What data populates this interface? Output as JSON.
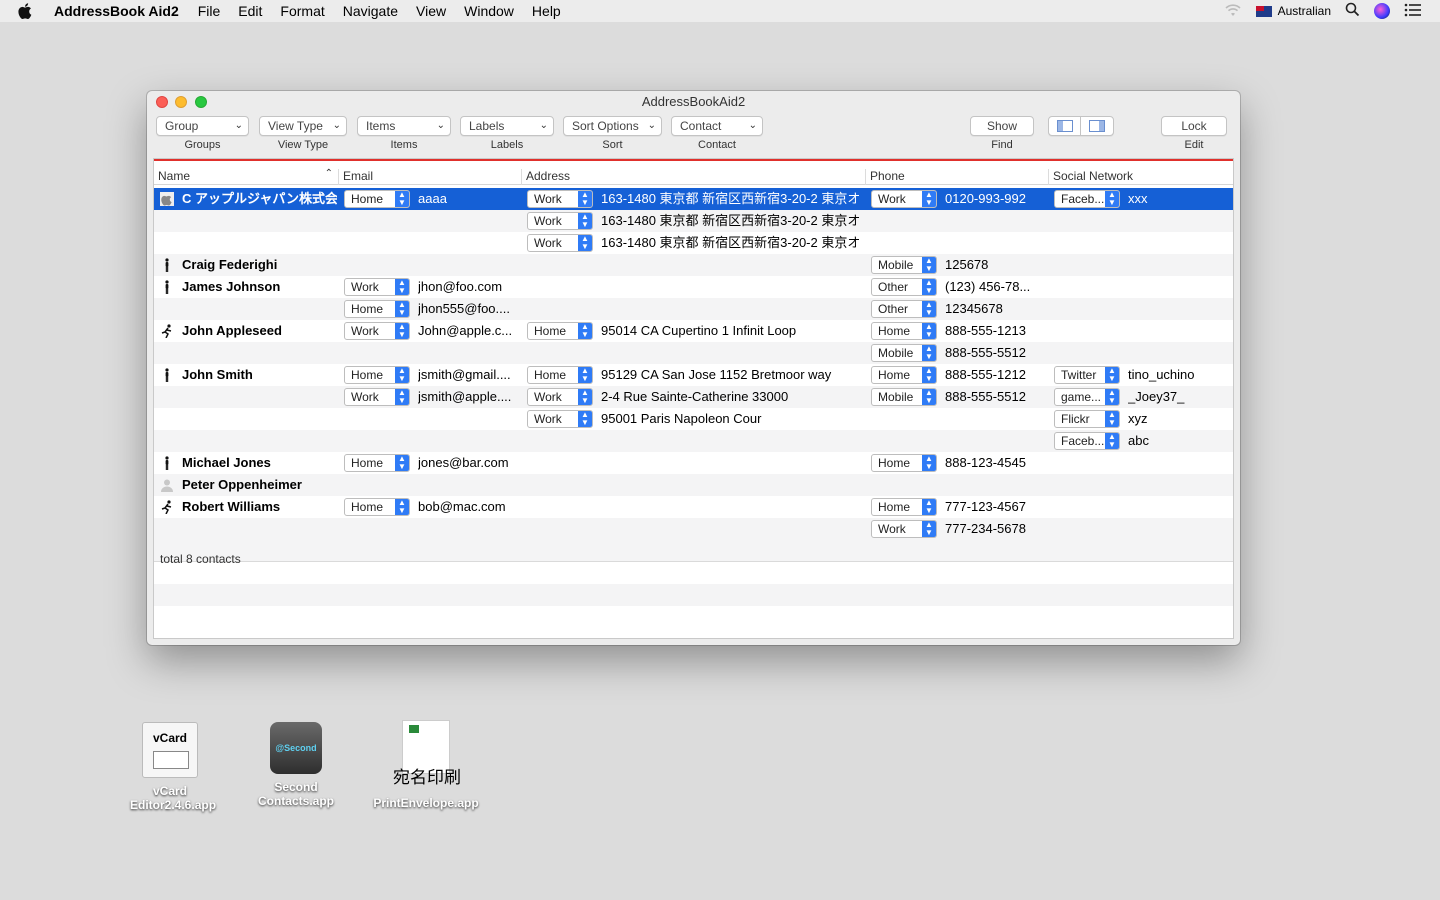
{
  "menubar": {
    "app_name": "AddressBook Aid2",
    "menus": [
      "File",
      "Edit",
      "Format",
      "Navigate",
      "View",
      "Window",
      "Help"
    ],
    "input_source": "Australian"
  },
  "window": {
    "title": "AddressBookAid2",
    "toolbar": {
      "group": {
        "label": "Group",
        "caption": "Groups"
      },
      "view_type": {
        "label": "View Type",
        "caption": "View Type"
      },
      "items": {
        "label": "Items",
        "caption": "Items"
      },
      "labels": {
        "label": "Labels",
        "caption": "Labels"
      },
      "sort": {
        "label": "Sort Options",
        "caption": "Sort"
      },
      "contact": {
        "label": "Contact",
        "caption": "Contact"
      },
      "show": {
        "label": "Show",
        "caption": "Find"
      },
      "lock": {
        "label": "Lock",
        "caption": "Edit"
      }
    },
    "columns": {
      "name": "Name",
      "email": "Email",
      "address": "Address",
      "phone": "Phone",
      "social": "Social Network"
    },
    "rows": [
      {
        "name": "C アップルジャパン株式会社",
        "icon": "apple",
        "email_label": "Home",
        "email": "aaaa",
        "addr_label": "Work",
        "address": "163-1480 東京都 新宿区西新宿3-20-2 東京オ…",
        "phone_label": "Work",
        "phone": "0120-993-992",
        "social_label": "Faceb...",
        "social": "xxx"
      },
      {
        "name": "",
        "addr_label": "Work",
        "address": "163-1480 東京都 新宿区西新宿3-20-2 東京オ…"
      },
      {
        "name": "",
        "addr_label": "Work",
        "address": "163-1480 東京都 新宿区西新宿3-20-2 東京オ…"
      },
      {
        "name": "Craig Federighi",
        "icon": "person",
        "phone_label": "Mobile",
        "phone": "125678"
      },
      {
        "name": "James Johnson",
        "icon": "person",
        "email_label": "Work",
        "email": "jhon@foo.com",
        "phone_label": "Other",
        "phone": "(123) 456-78..."
      },
      {
        "name": "",
        "email_label": "Home",
        "email": "jhon555@foo....",
        "phone_label": "Other",
        "phone": "12345678"
      },
      {
        "name": "John Appleseed",
        "icon": "runner",
        "email_label": "Work",
        "email": "John@apple.c...",
        "addr_label": "Home",
        "address": "95014 CA Cupertino 1 Infinit Loop",
        "phone_label": "Home",
        "phone": "888-555-1213"
      },
      {
        "name": "",
        "phone_label": "Mobile",
        "phone": "888-555-5512"
      },
      {
        "name": "John Smith",
        "icon": "person",
        "email_label": "Home",
        "email": "jsmith@gmail....",
        "addr_label": "Home",
        "address": "95129 CA San Jose 1152 Bretmoor way",
        "phone_label": "Home",
        "phone": "888-555-1212",
        "social_label": "Twitter",
        "social": "tino_uchino"
      },
      {
        "name": "",
        "email_label": "Work",
        "email": "jsmith@apple....",
        "addr_label": "Work",
        "address": "2-4 Rue Sainte-Catherine 33000",
        "phone_label": "Mobile",
        "phone": "888-555-5512",
        "social_label": "game...",
        "social": "_Joey37_"
      },
      {
        "name": "",
        "addr_label": "Work",
        "address": "95001 Paris Napoleon Cour",
        "social_label": "Flickr",
        "social": "xyz"
      },
      {
        "name": "",
        "social_label": "Faceb...",
        "social": "abc"
      },
      {
        "name": "Michael Jones",
        "icon": "person",
        "email_label": "Home",
        "email": "jones@bar.com",
        "phone_label": "Home",
        "phone": "888-123-4545"
      },
      {
        "name": "Peter Oppenheimer",
        "icon": "silhouette"
      },
      {
        "name": "Robert Williams",
        "icon": "runner",
        "email_label": "Home",
        "email": "bob@mac.com",
        "phone_label": "Home",
        "phone": "777-123-4567"
      },
      {
        "name": "",
        "phone_label": "Work",
        "phone": "777-234-5678"
      }
    ],
    "footer": "total 8 contacts"
  },
  "desktop": [
    {
      "name": "vCard Editor2.4.6.app",
      "icon_text": "vCard"
    },
    {
      "name": "Second Contacts.app",
      "icon_text": "@Second"
    },
    {
      "name": "PrintEnvelope.app",
      "icon_text": "宛名印刷"
    }
  ]
}
